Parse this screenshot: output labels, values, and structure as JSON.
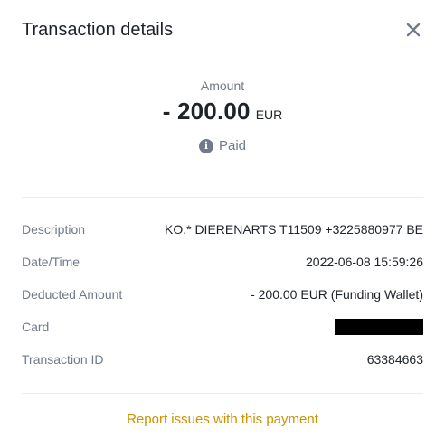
{
  "dialog": {
    "title": "Transaction details"
  },
  "amount": {
    "label": "Amount",
    "value": "- 200.00",
    "currency": "EUR",
    "status": "Paid"
  },
  "details": [
    {
      "label": "Description",
      "value": "KO.* DIERENARTS T11509 +3225880977 BE"
    },
    {
      "label": "Date/Time",
      "value": "2022-06-08 15:59:26"
    },
    {
      "label": "Deducted Amount",
      "value": "- 200.00 EUR (Funding Wallet)"
    },
    {
      "label": "Card",
      "value": ""
    },
    {
      "label": "Transaction ID",
      "value": "63384663"
    }
  ],
  "footer": {
    "report_link": "Report issues with this payment"
  },
  "colors": {
    "link": "#c99400",
    "muted": "#707a8a",
    "text": "#1e2329",
    "divider": "#eaecef"
  },
  "icons": {
    "close": "close-icon",
    "status": "info-icon"
  }
}
